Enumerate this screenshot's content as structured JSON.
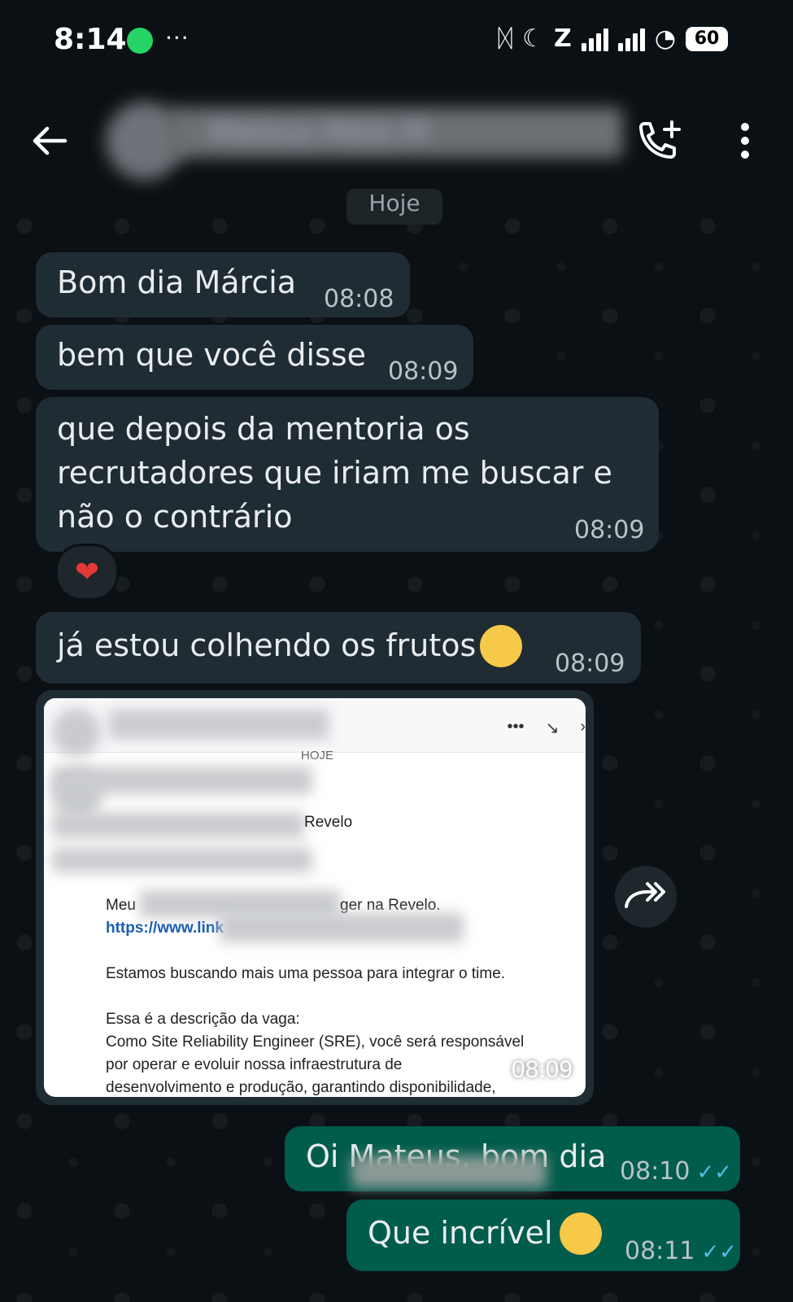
{
  "status_bar": {
    "time": "8:14",
    "dots": "···",
    "battery": "60"
  },
  "header": {
    "contact_name": "Mateus Melo M",
    "icons": [
      "back-arrow-icon",
      "add-call-icon",
      "more-vert-icon"
    ]
  },
  "date_chip": "Hoje",
  "messages": [
    {
      "text": "Bom dia Márcia",
      "time": "08:08",
      "direction": "in"
    },
    {
      "text": "bem que você disse",
      "time": "08:09",
      "direction": "in"
    },
    {
      "lines": [
        "que depois da mentoria os",
        "recrutadores que iriam me buscar e",
        "não o contrário"
      ],
      "time": "08:09",
      "direction": "in",
      "reaction": "❤"
    },
    {
      "text": "já estou colhendo os frutos",
      "emoji": "partying-face",
      "time": "08:09",
      "direction": "in"
    },
    {
      "type": "image",
      "time": "08:09",
      "direction": "in"
    },
    {
      "text": "Oi Mateus, bom dia",
      "time": "08:10",
      "direction": "out",
      "status": "read"
    },
    {
      "text": "Que incrível",
      "emoji": "smiling-face-with-hearts",
      "time": "08:11",
      "direction": "out",
      "status": "read"
    }
  ],
  "screenshot": {
    "day": "HOJE",
    "title": "Site Reliability Engineer na Revelo",
    "title_visible": "Revelo",
    "line1": "Meu",
    "line1_end": "ger na Revelo.",
    "link": "https://www.link",
    "line2": "Estamos buscando mais uma pessoa para integrar o time.",
    "line3": "Essa é a descrição da vaga:",
    "line4": "Como Site Reliability Engineer (SRE), você será responsável",
    "line5": "por operar e evoluir nossa infraestrutura de",
    "line6": "desenvolvimento e produção, garantindo disponibilidade,",
    "menu_dots": "•••"
  },
  "ticks": "✓✓"
}
